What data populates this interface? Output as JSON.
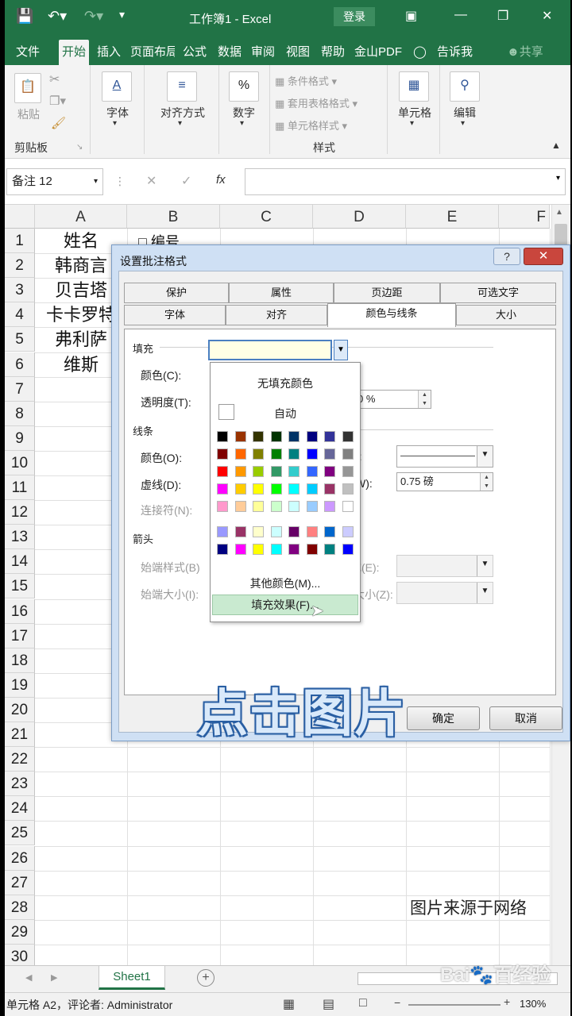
{
  "titlebar": {
    "save_icon": "save-icon",
    "undo_icon": "undo-icon",
    "redo_icon": "redo-icon",
    "customize_icon": "customize-icon",
    "title": "工作簿1 - Excel",
    "login": "登录",
    "min": "—",
    "restore": "❐",
    "close": "✕"
  },
  "tabs": [
    "文件",
    "开始",
    "插入",
    "页面布局",
    "公式",
    "数据",
    "审阅",
    "视图",
    "帮助",
    "金山PDF",
    "告诉我",
    "共享"
  ],
  "ribbon": {
    "paste": "粘贴",
    "clipboard": "剪贴板",
    "font": "字体",
    "align": "对齐方式",
    "number": "数字",
    "cond": "条件格式",
    "table": "套用表格格式",
    "cellstyle": "单元格样式",
    "styles": "样式",
    "cells": "单元格",
    "edit": "编辑"
  },
  "formula": {
    "namebox": "备注 12",
    "fx": "fx",
    "cancel": "✕",
    "enter": "✓"
  },
  "columns": [
    "A",
    "B",
    "C",
    "D",
    "E",
    "F"
  ],
  "rows": [
    "1",
    "2",
    "3",
    "4",
    "5",
    "6",
    "7",
    "8",
    "9",
    "10",
    "11",
    "12",
    "13",
    "14",
    "15",
    "16",
    "17",
    "18",
    "19",
    "20",
    "21",
    "22",
    "23",
    "24",
    "25",
    "26",
    "27",
    "28",
    "29",
    "30"
  ],
  "cellsA": [
    "姓名",
    "韩商言",
    "贝吉塔",
    "卡卡罗特",
    "弗利萨",
    "维斯"
  ],
  "cellB1": "编号",
  "dialog": {
    "title": "设置批注格式",
    "help": "?",
    "close": "✕",
    "tabs_row1": [
      "保护",
      "属性",
      "页边距",
      "可选文字"
    ],
    "tabs_row2": [
      "字体",
      "对齐",
      "颜色与线条",
      "大小"
    ],
    "fill": "填充",
    "color": "颜色(C):",
    "transparency": "透明度(T):",
    "transparency_value": "0 %",
    "line": "线条",
    "line_color": "颜色(O):",
    "dash": "虚线(D):",
    "connector": "连接符(N):",
    "style_suffix": "):",
    "weight_suffix": "W):",
    "weight_value": "0.75 磅",
    "arrows": "箭头",
    "begin_style": "始端样式(B)",
    "begin_size": "始端大小(I):",
    "end_style_suffix": "式(E):",
    "end_size_suffix": "大小(Z):",
    "ok": "确定",
    "cancel": "取消"
  },
  "palette": {
    "no_fill": "无填充颜色",
    "auto": "自动",
    "more": "其他颜色(M)...",
    "fill_effects": "填充效果(F)...",
    "colors": [
      [
        "#000000",
        "#993300",
        "#333300",
        "#003300",
        "#003366",
        "#000080",
        "#333399",
        "#333333"
      ],
      [
        "#800000",
        "#FF6600",
        "#808000",
        "#008000",
        "#008080",
        "#0000FF",
        "#666699",
        "#808080"
      ],
      [
        "#FF0000",
        "#FF9900",
        "#99CC00",
        "#339966",
        "#33CCCC",
        "#3366FF",
        "#800080",
        "#969696"
      ],
      [
        "#FF00FF",
        "#FFCC00",
        "#FFFF00",
        "#00FF00",
        "#00FFFF",
        "#00CCFF",
        "#993366",
        "#C0C0C0"
      ],
      [
        "#FF99CC",
        "#FFCC99",
        "#FFFF99",
        "#CCFFCC",
        "#CCFFFF",
        "#99CCFF",
        "#CC99FF",
        "#FFFFFF"
      ]
    ],
    "colors2": [
      [
        "#9999FF",
        "#993366",
        "#FFFFCC",
        "#CCFFFF",
        "#660066",
        "#FF8080",
        "#0066CC",
        "#CCCCFF"
      ],
      [
        "#000080",
        "#FF00FF",
        "#FFFF00",
        "#00FFFF",
        "#800080",
        "#800000",
        "#008080",
        "#0000FF"
      ]
    ]
  },
  "overlay": "点击图片",
  "source": "图片来源于网络",
  "sheet": {
    "name": "Sheet1",
    "add": "+"
  },
  "status": {
    "text": "单元格 A2，评论者: Administrator",
    "zoom": "130%"
  },
  "watermark": "Bai百经验"
}
